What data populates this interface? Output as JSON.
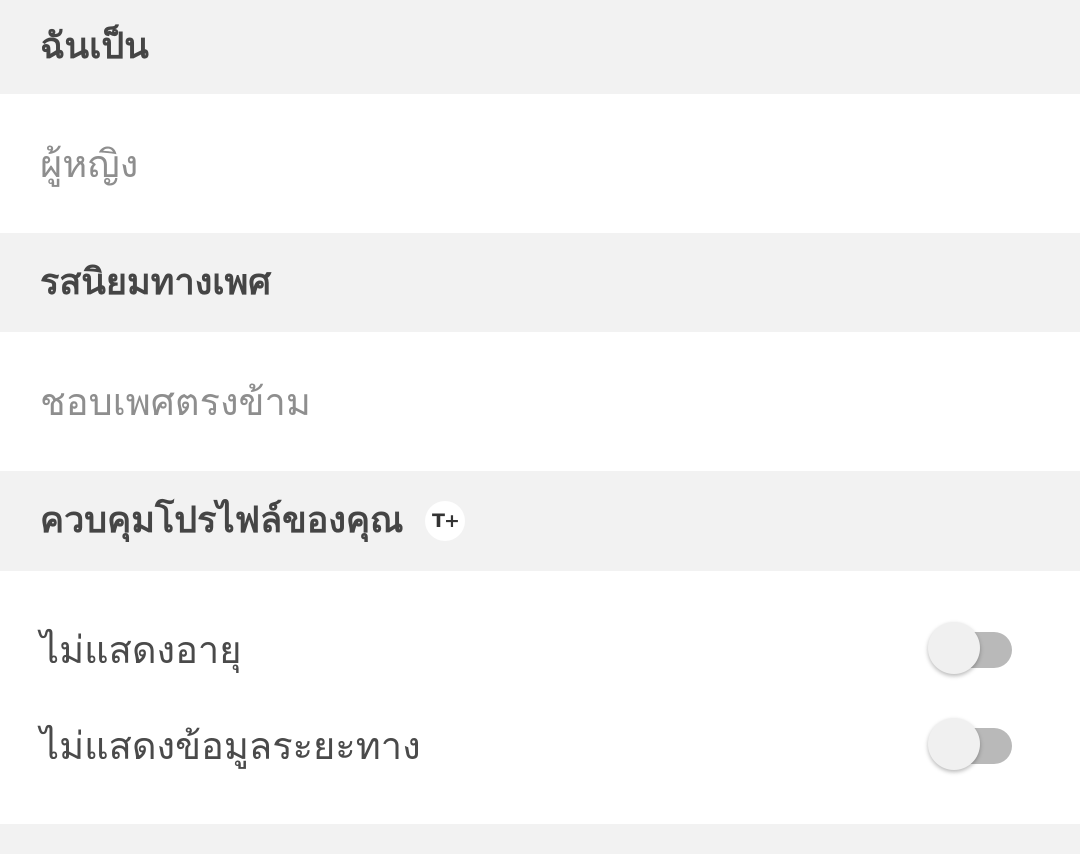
{
  "gender": {
    "header": "ฉันเป็น",
    "value": "ผู้หญิง"
  },
  "orientation": {
    "header": "รสนิยมทางเพศ",
    "value": "ชอบเพศตรงข้าม"
  },
  "profile_control": {
    "header": "ควบคุมโปรไฟล์ของคุณ",
    "badge": "T+",
    "toggles": [
      {
        "label": "ไม่แสดงอายุ",
        "state": "off"
      },
      {
        "label": "ไม่แสดงข้อมูลระยะทาง",
        "state": "off"
      }
    ]
  },
  "colors": {
    "section_background": "#f2f2f2",
    "row_background": "#ffffff",
    "header_text": "#454545",
    "value_text": "#8e8e8e",
    "toggle_track_off": "#b9b9b9",
    "toggle_knob": "#f0f0f0"
  }
}
